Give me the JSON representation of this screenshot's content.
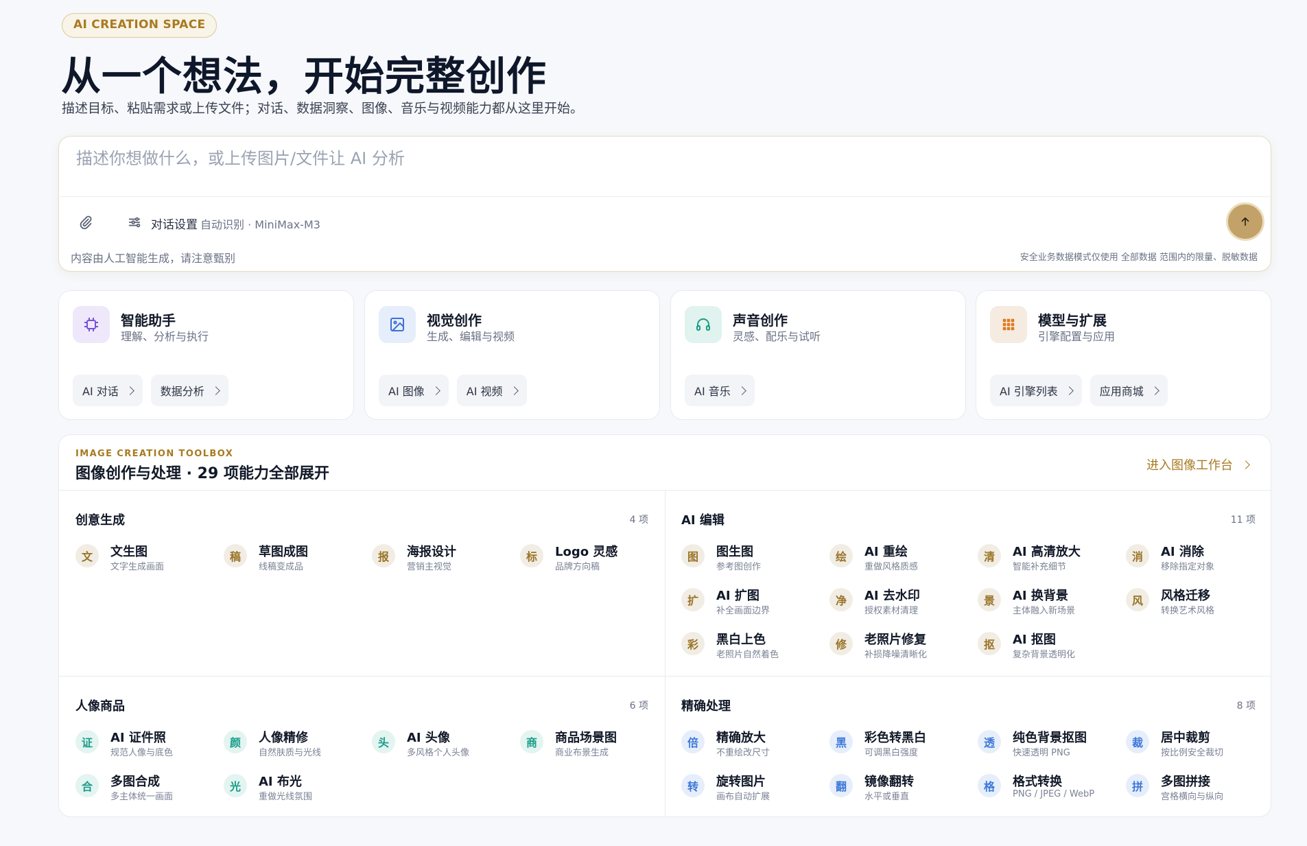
{
  "hero": {
    "badge": "AI CREATION SPACE",
    "title": "从一个想法，开始完整创作",
    "subtitle": "描述目标、粘贴需求或上传文件；对话、数据洞察、图像、音乐与视频能力都从这里开始。"
  },
  "composer": {
    "placeholder": "描述你想做什么，或上传图片/文件让 AI 分析",
    "settings_label": "对话设置",
    "settings_meta": "自动识别 · MiniMax-M3",
    "note_left": "内容由人工智能生成，请注意甄别",
    "note_right": "安全业务数据模式仅使用 全部数据 范围内的限量、脱敏数据",
    "icons": {
      "attach": "paperclip-icon",
      "settings": "sliders-icon",
      "send": "arrow-up-icon"
    }
  },
  "categories": [
    {
      "title": "智能助手",
      "subtitle": "理解、分析与执行",
      "icon": "chip-icon",
      "color": "#7c4fd6",
      "bg": "#efe8fb",
      "chips": [
        "AI 对话",
        "数据分析"
      ]
    },
    {
      "title": "视觉创作",
      "subtitle": "生成、编辑与视频",
      "icon": "image-icon",
      "color": "#3d6fd8",
      "bg": "#e6eefb",
      "chips": [
        "AI 图像",
        "AI 视频"
      ]
    },
    {
      "title": "声音创作",
      "subtitle": "灵感、配乐与试听",
      "icon": "headphones-icon",
      "color": "#1a9d88",
      "bg": "#e0f3ef",
      "chips": [
        "AI 音乐"
      ]
    },
    {
      "title": "模型与扩展",
      "subtitle": "引擎配置与应用",
      "icon": "grid-icon",
      "color": "#e07a1f",
      "bg": "#f5ebe0",
      "chips": [
        "AI 引擎列表",
        "应用商城"
      ]
    }
  ],
  "toolbox": {
    "eyebrow": "IMAGE CREATION TOOLBOX",
    "title": "图像创作与处理 · 29 项能力全部展开",
    "link": "进入图像工作台",
    "sections": [
      {
        "title": "创意生成",
        "count": "4 项",
        "tone": "gold",
        "items": [
          {
            "g": "文",
            "name": "文生图",
            "desc": "文字生成画面"
          },
          {
            "g": "稿",
            "name": "草图成图",
            "desc": "线稿变成品"
          },
          {
            "g": "报",
            "name": "海报设计",
            "desc": "营销主视觉"
          },
          {
            "g": "标",
            "name": "Logo 灵感",
            "desc": "品牌方向稿"
          }
        ]
      },
      {
        "title": "AI 编辑",
        "count": "11 项",
        "tone": "gold",
        "items": [
          {
            "g": "图",
            "name": "图生图",
            "desc": "参考图创作"
          },
          {
            "g": "绘",
            "name": "AI 重绘",
            "desc": "重做风格质感"
          },
          {
            "g": "清",
            "name": "AI 高清放大",
            "desc": "智能补充细节"
          },
          {
            "g": "消",
            "name": "AI 消除",
            "desc": "移除指定对象"
          },
          {
            "g": "扩",
            "name": "AI 扩图",
            "desc": "补全画面边界"
          },
          {
            "g": "净",
            "name": "AI 去水印",
            "desc": "授权素材清理"
          },
          {
            "g": "景",
            "name": "AI 换背景",
            "desc": "主体融入新场景"
          },
          {
            "g": "风",
            "name": "风格迁移",
            "desc": "转换艺术风格"
          },
          {
            "g": "彩",
            "name": "黑白上色",
            "desc": "老照片自然着色"
          },
          {
            "g": "修",
            "name": "老照片修复",
            "desc": "补损降噪清晰化"
          },
          {
            "g": "抠",
            "name": "AI 抠图",
            "desc": "复杂背景透明化"
          }
        ]
      },
      {
        "title": "人像商品",
        "count": "6 项",
        "tone": "teal",
        "items": [
          {
            "g": "证",
            "name": "AI 证件照",
            "desc": "规范人像与底色"
          },
          {
            "g": "颜",
            "name": "人像精修",
            "desc": "自然肤质与光线"
          },
          {
            "g": "头",
            "name": "AI 头像",
            "desc": "多风格个人头像"
          },
          {
            "g": "商",
            "name": "商品场景图",
            "desc": "商业布景生成"
          },
          {
            "g": "合",
            "name": "多图合成",
            "desc": "多主体统一画面"
          },
          {
            "g": "光",
            "name": "AI 布光",
            "desc": "重做光线氛围"
          }
        ]
      },
      {
        "title": "精确处理",
        "count": "8 项",
        "tone": "blue",
        "items": [
          {
            "g": "倍",
            "name": "精确放大",
            "desc": "不重绘改尺寸"
          },
          {
            "g": "黑",
            "name": "彩色转黑白",
            "desc": "可调黑白强度"
          },
          {
            "g": "透",
            "name": "纯色背景抠图",
            "desc": "快速透明 PNG"
          },
          {
            "g": "裁",
            "name": "居中裁剪",
            "desc": "按比例安全裁切"
          },
          {
            "g": "转",
            "name": "旋转图片",
            "desc": "画布自动扩展"
          },
          {
            "g": "翻",
            "name": "镜像翻转",
            "desc": "水平或垂直"
          },
          {
            "g": "格",
            "name": "格式转换",
            "desc": "PNG / JPEG / WebP"
          },
          {
            "g": "拼",
            "name": "多图拼接",
            "desc": "宫格横向与纵向"
          }
        ]
      }
    ]
  }
}
